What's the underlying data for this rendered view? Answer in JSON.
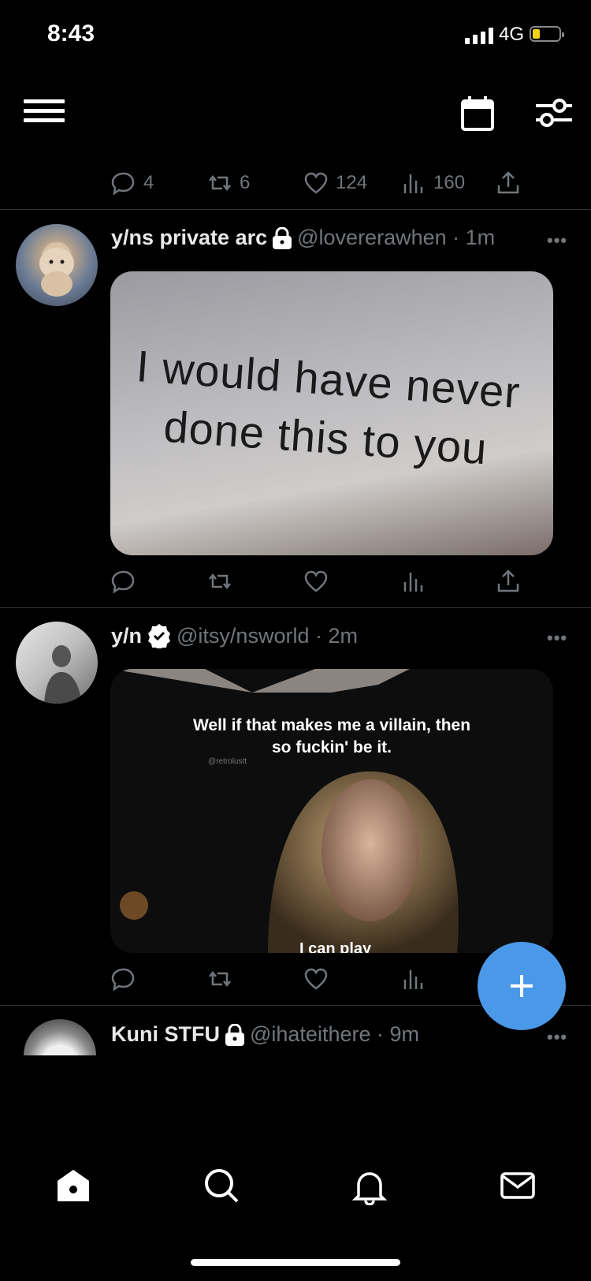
{
  "status_bar": {
    "time": "8:43",
    "network": "4G",
    "battery_level": 0.25
  },
  "header": {
    "menu_icon": "hamburger-menu-icon",
    "schedule_icon": "calendar-icon",
    "filter_icon": "sliders-icon"
  },
  "top_stats": {
    "replies": "4",
    "retweets": "6",
    "likes": "124",
    "views": "160"
  },
  "tweets": [
    {
      "display_name": "y/ns private arc",
      "protected": true,
      "handle_time": "@lovererawhen · 1m",
      "image_text_line1": "I would have never",
      "image_text_line2": "done this to you"
    },
    {
      "display_name": "y/n",
      "verified": true,
      "handle_time": "@itsy/nsworld · 2m",
      "caption_line1": "Well if that makes me a villain, then",
      "caption_line2": "so fuckin' be it.",
      "watermark": "@retrolustt",
      "subtitle_partial": "I can play"
    },
    {
      "display_name": "Kuni STFU",
      "protected": true,
      "handle_time": "@ihateithere · 9m"
    }
  ],
  "more_label": "•••",
  "fab_icon": "compose-plus-icon",
  "bottom_nav": [
    "home-icon",
    "search-icon",
    "bell-icon",
    "mail-icon"
  ],
  "colors": {
    "accent": "#4a99e9",
    "muted": "#71767b",
    "background": "#000000"
  }
}
